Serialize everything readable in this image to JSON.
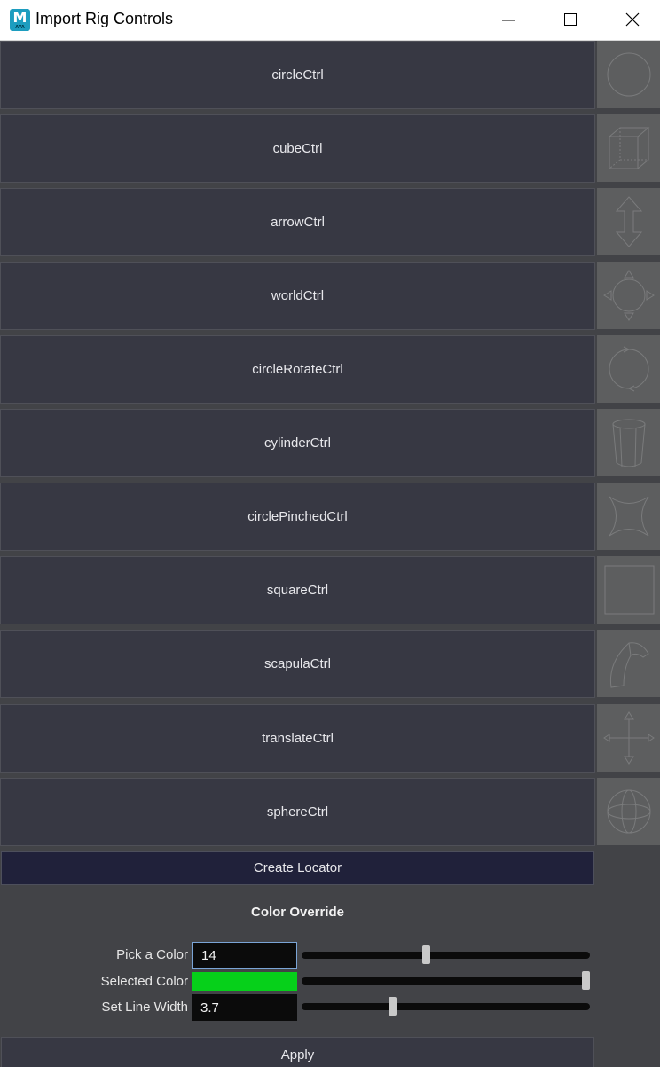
{
  "window": {
    "title": "Import Rig Controls",
    "app_icon_letter": "M",
    "app_icon_sub": "AYA"
  },
  "controls": [
    {
      "label": "circleCtrl",
      "icon": "circle-ctrl-thumbnail"
    },
    {
      "label": "cubeCtrl",
      "icon": "cube-ctrl-thumbnail"
    },
    {
      "label": "arrowCtrl",
      "icon": "arrow-ctrl-thumbnail"
    },
    {
      "label": "worldCtrl",
      "icon": "world-ctrl-thumbnail"
    },
    {
      "label": "circleRotateCtrl",
      "icon": "circle-rotate-ctrl-thumbnail"
    },
    {
      "label": "cylinderCtrl",
      "icon": "cylinder-ctrl-thumbnail"
    },
    {
      "label": "circlePinchedCtrl",
      "icon": "circle-pinched-ctrl-thumbnail"
    },
    {
      "label": "squareCtrl",
      "icon": "square-ctrl-thumbnail"
    },
    {
      "label": "scapulaCtrl",
      "icon": "scapula-ctrl-thumbnail"
    },
    {
      "label": "translateCtrl",
      "icon": "translate-ctrl-thumbnail"
    },
    {
      "label": "sphereCtrl",
      "icon": "sphere-ctrl-thumbnail"
    }
  ],
  "locator_button": "Create Locator",
  "color_override": {
    "title": "Color Override",
    "pick_color_label": "Pick a Color",
    "pick_color_value": "14",
    "pick_color_slider": 0.43,
    "selected_color_label": "Selected Color",
    "selected_color_hex": "#06d01a",
    "selected_color_slider": 1.0,
    "line_width_label": "Set Line Width",
    "line_width_value": "3.7",
    "line_width_slider": 0.31
  },
  "apply_button": "Apply",
  "colors": {
    "button_bg": "#373843",
    "locator_bg": "#20213a",
    "panel_bg": "#424347",
    "thumb_bg": "#5d5e5f"
  }
}
